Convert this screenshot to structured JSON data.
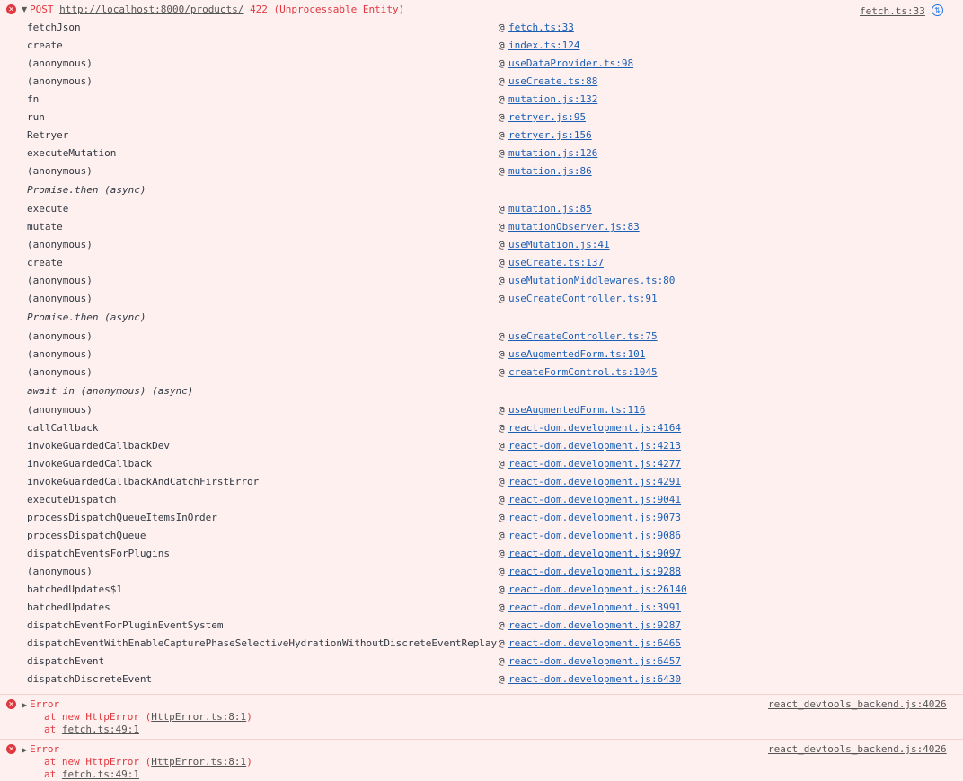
{
  "main_error": {
    "method": "POST",
    "url": "http://localhost:8000/products/",
    "status": "422 (Unprocessable Entity)",
    "source": "fetch.ts:33",
    "stack": [
      {
        "fn": "fetchJson",
        "loc": "fetch.ts:33"
      },
      {
        "fn": "create",
        "loc": "index.ts:124"
      },
      {
        "fn": "(anonymous)",
        "loc": "useDataProvider.ts:98"
      },
      {
        "fn": "(anonymous)",
        "loc": "useCreate.ts:88"
      },
      {
        "fn": "fn",
        "loc": "mutation.js:132"
      },
      {
        "fn": "run",
        "loc": "retryer.js:95"
      },
      {
        "fn": "Retryer",
        "loc": "retryer.js:156"
      },
      {
        "fn": "executeMutation",
        "loc": "mutation.js:126"
      },
      {
        "fn": "(anonymous)",
        "loc": "mutation.js:86"
      },
      {
        "async": "Promise.then (async)"
      },
      {
        "fn": "execute",
        "loc": "mutation.js:85"
      },
      {
        "fn": "mutate",
        "loc": "mutationObserver.js:83"
      },
      {
        "fn": "(anonymous)",
        "loc": "useMutation.js:41"
      },
      {
        "fn": "create",
        "loc": "useCreate.ts:137"
      },
      {
        "fn": "(anonymous)",
        "loc": "useMutationMiddlewares.ts:80"
      },
      {
        "fn": "(anonymous)",
        "loc": "useCreateController.ts:91"
      },
      {
        "async": "Promise.then (async)"
      },
      {
        "fn": "(anonymous)",
        "loc": "useCreateController.ts:75"
      },
      {
        "fn": "(anonymous)",
        "loc": "useAugmentedForm.ts:101"
      },
      {
        "fn": "(anonymous)",
        "loc": "createFormControl.ts:1045"
      },
      {
        "async": "await in (anonymous) (async)"
      },
      {
        "fn": "(anonymous)",
        "loc": "useAugmentedForm.ts:116"
      },
      {
        "fn": "callCallback",
        "loc": "react-dom.development.js:4164"
      },
      {
        "fn": "invokeGuardedCallbackDev",
        "loc": "react-dom.development.js:4213"
      },
      {
        "fn": "invokeGuardedCallback",
        "loc": "react-dom.development.js:4277"
      },
      {
        "fn": "invokeGuardedCallbackAndCatchFirstError",
        "loc": "react-dom.development.js:4291"
      },
      {
        "fn": "executeDispatch",
        "loc": "react-dom.development.js:9041"
      },
      {
        "fn": "processDispatchQueueItemsInOrder",
        "loc": "react-dom.development.js:9073"
      },
      {
        "fn": "processDispatchQueue",
        "loc": "react-dom.development.js:9086"
      },
      {
        "fn": "dispatchEventsForPlugins",
        "loc": "react-dom.development.js:9097"
      },
      {
        "fn": "(anonymous)",
        "loc": "react-dom.development.js:9288"
      },
      {
        "fn": "batchedUpdates$1",
        "loc": "react-dom.development.js:26140"
      },
      {
        "fn": "batchedUpdates",
        "loc": "react-dom.development.js:3991"
      },
      {
        "fn": "dispatchEventForPluginEventSystem",
        "loc": "react-dom.development.js:9287"
      },
      {
        "fn": "dispatchEventWithEnableCapturePhaseSelectiveHydrationWithoutDiscreteEventReplay",
        "loc": "react-dom.development.js:6465"
      },
      {
        "fn": "dispatchEvent",
        "loc": "react-dom.development.js:6457"
      },
      {
        "fn": "dispatchDiscreteEvent",
        "loc": "react-dom.development.js:6430"
      }
    ]
  },
  "errors": [
    {
      "title": "Error",
      "source": "react_devtools_backend.js:4026",
      "line1_prefix": "at new HttpError (",
      "line1_loc": "HttpError.ts:8:1",
      "line1_suffix": ")",
      "line2_prefix": "at ",
      "line2_loc": "fetch.ts:49:1"
    },
    {
      "title": "Error",
      "source": "react_devtools_backend.js:4026",
      "line1_prefix": "at new HttpError (",
      "line1_loc": "HttpError.ts:8:1",
      "line1_suffix": ")",
      "line2_prefix": "at ",
      "line2_loc": "fetch.ts:49:1"
    }
  ],
  "icons": {
    "error": "error-circle-icon",
    "expand": "triangle-icon",
    "network": "network-request-icon"
  },
  "symbols": {
    "at_sign": "@"
  },
  "colors": {
    "background": "#fff0f0",
    "error_text": "#e0383e",
    "link": "#1a5fb4"
  }
}
